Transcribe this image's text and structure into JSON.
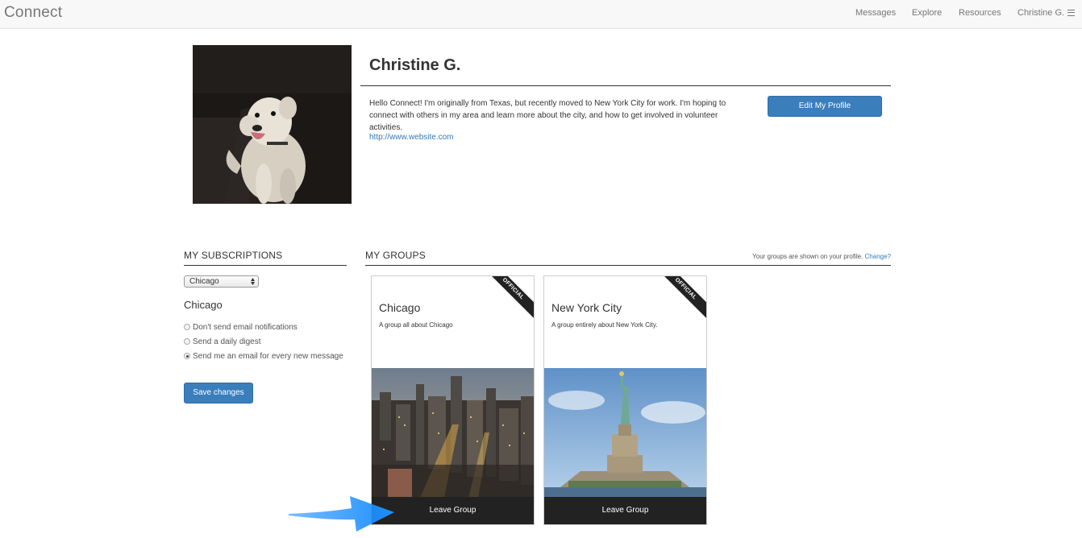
{
  "navbar": {
    "brand": "Connect",
    "links": [
      "Messages",
      "Explore",
      "Resources"
    ],
    "user_menu": "Christine G."
  },
  "profile": {
    "name": "Christine G.",
    "bio": "Hello Connect! I'm originally from Texas, but recently moved to New York City for work. I'm hoping to connect with others in my area and learn more about the city, and how to get involved in volunteer activities.",
    "website": "http://www.website.com",
    "edit_button": "Edit My Profile"
  },
  "subscriptions": {
    "heading": "MY SUBSCRIPTIONS",
    "selected_city": "Chicago",
    "city_heading": "Chicago",
    "options": [
      {
        "label": "Don't send email notifications",
        "checked": false
      },
      {
        "label": "Send a daily digest",
        "checked": false
      },
      {
        "label": "Send me an email for every new message",
        "checked": true
      }
    ],
    "save_button": "Save changes"
  },
  "groups": {
    "heading": "MY GROUPS",
    "note": "Your groups are shown on your profile.",
    "note_link": "Change?",
    "items": [
      {
        "name": "Chicago",
        "description": "A group all about Chicago",
        "badge": "OFFICIAL",
        "leave_label": "Leave Group"
      },
      {
        "name": "New York City",
        "description": "A group entirely about New York City.",
        "badge": "OFFICIAL",
        "leave_label": "Leave Group"
      }
    ]
  },
  "colors": {
    "primary_button": "#3a7ebc",
    "link": "#337ab7",
    "dark_bar": "#222222",
    "annotation_arrow": "#1e90ff"
  }
}
